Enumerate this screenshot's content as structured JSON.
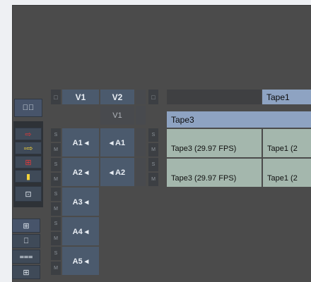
{
  "toolbar": {
    "monitor_icon": "▤⃒",
    "arrow_icon": "⇨",
    "dots_arrow_icon": "▫⇨",
    "red_grid_icon": "⊞",
    "yellow_icon": "▮",
    "image_icon": "⊡",
    "bottom_icons": [
      "⊞",
      "⎕",
      "⩶",
      "⊞"
    ]
  },
  "tracks": {
    "header_sm": "□",
    "v1": "V1",
    "v2": "V2",
    "v1_record": "V1",
    "s": "S",
    "m": "M",
    "audio": [
      {
        "src": "A1 ◂",
        "rec": "◂ A1"
      },
      {
        "src": "A2 ◂",
        "rec": "◂ A2"
      },
      {
        "src": "A3 ◂",
        "rec": ""
      },
      {
        "src": "A4 ◂",
        "rec": ""
      },
      {
        "src": "A5 ◂",
        "rec": ""
      }
    ]
  },
  "timeline": {
    "tape1_header": "Tape1",
    "tape3_header": "Tape3",
    "rows": [
      {
        "c1": "Tape3 (29.97 FPS)",
        "c2": "Tape1 (2"
      },
      {
        "c1": "Tape3 (29.97 FPS)",
        "c2": "Tape1 (2"
      }
    ]
  },
  "colors": {
    "track_blue": "#4b5a6d",
    "clip_green": "#a4b7ad",
    "header_blue": "#8ea3c2",
    "background": "#4b4b4b"
  }
}
